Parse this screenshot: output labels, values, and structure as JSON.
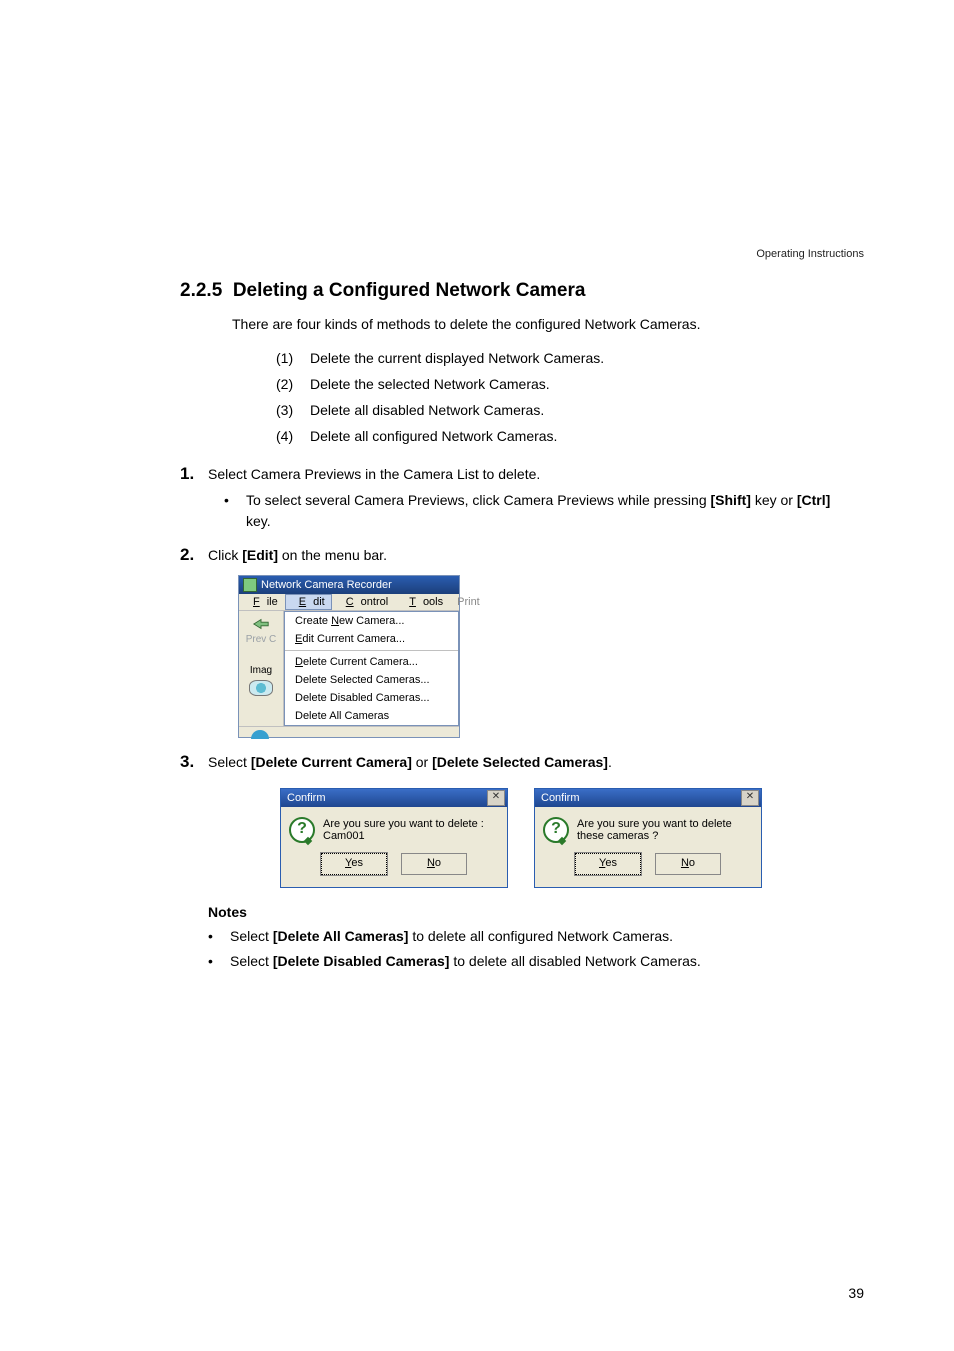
{
  "running_head": "Operating Instructions",
  "section": {
    "number": "2.2.5",
    "title": "Deleting a Configured Network Camera"
  },
  "intro": "There are four kinds of methods to delete the configured Network Cameras.",
  "methods": [
    {
      "num": "(1)",
      "text": "Delete the current displayed Network Cameras."
    },
    {
      "num": "(2)",
      "text": "Delete the selected Network Cameras."
    },
    {
      "num": "(3)",
      "text": "Delete all disabled Network Cameras."
    },
    {
      "num": "(4)",
      "text": "Delete all configured Network Cameras."
    }
  ],
  "steps": {
    "s1": {
      "num": "1.",
      "text": "Select Camera Previews in the Camera List to delete.",
      "bullet_pre": "To select several Camera Previews, click Camera Previews while pressing ",
      "shift": "[Shift]",
      "mid": " key or ",
      "ctrl": "[Ctrl]",
      "post": " key."
    },
    "s2": {
      "num": "2.",
      "pre": "Click ",
      "edit": "[Edit]",
      "post": " on the menu bar."
    },
    "s3": {
      "num": "3.",
      "pre": "Select ",
      "opt1": "[Delete Current Camera]",
      "or": " or ",
      "opt2": "[Delete Selected Cameras]",
      "post": "."
    }
  },
  "menu": {
    "title": "Network Camera Recorder",
    "menubar": {
      "file": "File",
      "edit": "Edit",
      "control": "Control",
      "tools": "Tools",
      "print": "Print"
    },
    "left": {
      "prev": "Prev C",
      "image": "Imag"
    },
    "items": {
      "create": "Create New Camera...",
      "editcam": "Edit Current Camera...",
      "delcur": "Delete Current Camera...",
      "delsel": "Delete Selected Cameras...",
      "deldis": "Delete Disabled Cameras...",
      "delall": "Delete All Cameras"
    }
  },
  "dialog1": {
    "title": "Confirm",
    "text": "Are you sure you want to delete : Cam001",
    "yes": "Yes",
    "no": "No"
  },
  "dialog2": {
    "title": "Confirm",
    "text": "Are you sure you want to delete these cameras ?",
    "yes": "Yes",
    "no": "No"
  },
  "notes": {
    "heading": "Notes",
    "n1_pre": "Select ",
    "n1_bold": "[Delete All Cameras]",
    "n1_post": " to delete all configured Network Cameras.",
    "n2_pre": "Select ",
    "n2_bold": "[Delete Disabled Cameras]",
    "n2_post": " to delete all disabled Network Cameras."
  },
  "page_number": "39"
}
